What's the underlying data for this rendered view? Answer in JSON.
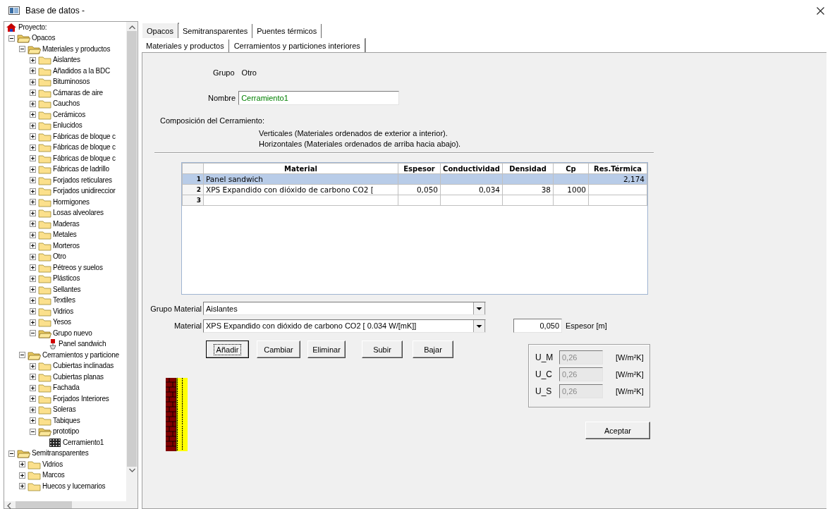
{
  "window": {
    "title": "Base de datos -"
  },
  "tree": [
    {
      "label": "Proyecto:",
      "kind": "root"
    },
    {
      "label": "Opacos",
      "kind": "folder",
      "expanded": true,
      "children": [
        {
          "label": "Materiales y productos",
          "kind": "folder",
          "expanded": true,
          "children": [
            {
              "label": "Aislantes",
              "kind": "folder",
              "expanded": false
            },
            {
              "label": "Añadidos a la BDC",
              "kind": "folder",
              "expanded": false
            },
            {
              "label": "Bituminosos",
              "kind": "folder",
              "expanded": false
            },
            {
              "label": "Cámaras de aire",
              "kind": "folder",
              "expanded": false
            },
            {
              "label": "Cauchos",
              "kind": "folder",
              "expanded": false
            },
            {
              "label": "Cerámicos",
              "kind": "folder",
              "expanded": false
            },
            {
              "label": "Enlucidos",
              "kind": "folder",
              "expanded": false
            },
            {
              "label": "Fábricas de bloque c",
              "kind": "folder",
              "expanded": false
            },
            {
              "label": "Fábricas de bloque c",
              "kind": "folder",
              "expanded": false
            },
            {
              "label": "Fábricas de bloque c",
              "kind": "folder",
              "expanded": false
            },
            {
              "label": "Fábricas de ladrillo",
              "kind": "folder",
              "expanded": false
            },
            {
              "label": "Forjados reticulares",
              "kind": "folder",
              "expanded": false
            },
            {
              "label": "Forjados unidireccior",
              "kind": "folder",
              "expanded": false
            },
            {
              "label": "Hormigones",
              "kind": "folder",
              "expanded": false
            },
            {
              "label": "Losas alveolares",
              "kind": "folder",
              "expanded": false
            },
            {
              "label": "Maderas",
              "kind": "folder",
              "expanded": false
            },
            {
              "label": "Metales",
              "kind": "folder",
              "expanded": false
            },
            {
              "label": "Morteros",
              "kind": "folder",
              "expanded": false
            },
            {
              "label": "Otro",
              "kind": "folder",
              "expanded": false
            },
            {
              "label": "Pétreos y suelos",
              "kind": "folder",
              "expanded": false
            },
            {
              "label": "Plásticos",
              "kind": "folder",
              "expanded": false
            },
            {
              "label": "Sellantes",
              "kind": "folder",
              "expanded": false
            },
            {
              "label": "Textiles",
              "kind": "folder",
              "expanded": false
            },
            {
              "label": "Vidrios",
              "kind": "folder",
              "expanded": false
            },
            {
              "label": "Yesos",
              "kind": "folder",
              "expanded": false
            },
            {
              "label": "Grupo nuevo",
              "kind": "folder",
              "expanded": true,
              "children": [
                {
                  "label": "Panel sandwich",
                  "kind": "material"
                }
              ]
            }
          ]
        },
        {
          "label": "Cerramientos y particione",
          "kind": "folder",
          "expanded": true,
          "children": [
            {
              "label": "Cubiertas inclinadas",
              "kind": "folder",
              "expanded": false
            },
            {
              "label": "Cubiertas planas",
              "kind": "folder",
              "expanded": false
            },
            {
              "label": "Fachada",
              "kind": "folder",
              "expanded": false
            },
            {
              "label": "Forjados Interiores",
              "kind": "folder",
              "expanded": false
            },
            {
              "label": "Soleras",
              "kind": "folder",
              "expanded": false
            },
            {
              "label": "Tabiques",
              "kind": "folder",
              "expanded": false
            },
            {
              "label": "prototipo",
              "kind": "folder",
              "expanded": true,
              "children": [
                {
                  "label": "Cerramiento1",
                  "kind": "cerramiento"
                }
              ]
            }
          ]
        }
      ]
    },
    {
      "label": "Semitransparentes",
      "kind": "folder",
      "expanded": true,
      "children": [
        {
          "label": "Vidrios",
          "kind": "folder",
          "expanded": false
        },
        {
          "label": "Marcos",
          "kind": "folder",
          "expanded": false
        },
        {
          "label": "Huecos y lucernarios",
          "kind": "folder",
          "expanded": false
        }
      ]
    }
  ],
  "tabs": [
    {
      "label": "Opacos",
      "selected": true
    },
    {
      "label": "Semitransparentes",
      "selected": false
    },
    {
      "label": "Puentes térmicos",
      "selected": false
    }
  ],
  "subtabs": [
    {
      "label": "Materiales y productos",
      "selected": false
    },
    {
      "label": "Cerramientos y particiones interiores",
      "selected": true
    }
  ],
  "grupo": {
    "label": "Grupo",
    "value": "Otro"
  },
  "nombre": {
    "label": "Nombre",
    "value": "Cerramiento1"
  },
  "composicion": {
    "title": "Composición del Cerramiento:",
    "notes": [
      "Verticales (Materiales ordenados de exterior a interior).",
      "Horizontales (Materiales ordenados de arriba hacia abajo)."
    ]
  },
  "table": {
    "columns": [
      "Material",
      "Espesor",
      "Conductividad",
      "Densidad",
      "Cp",
      "Res.Térmica"
    ],
    "rows": [
      {
        "number": "1",
        "selected": true,
        "cells": {
          "material": "Panel sandwich",
          "res_termica": "2,174"
        }
      },
      {
        "number": "2",
        "selected": false,
        "cells": {
          "material": "XPS Expandido con dióxido de carbono CO2 [",
          "espesor": "0,050",
          "conductividad": "0,034",
          "densidad": "38",
          "cp": "1000"
        }
      },
      {
        "number": "3",
        "selected": false,
        "cells": {}
      }
    ]
  },
  "grupo_material": {
    "label": "Grupo Material",
    "value": "Aislantes"
  },
  "material": {
    "label": "Material",
    "value": "XPS Expandido con dióxido de carbono CO2 [ 0.034 W/[mK]]"
  },
  "espesor": {
    "value": "0,050",
    "label": "Espesor [m]"
  },
  "buttons": [
    {
      "label": "Añadir",
      "focused": true
    },
    {
      "label": "Cambiar",
      "focused": false
    },
    {
      "label": "Eliminar",
      "focused": false
    },
    {
      "label": "Subir",
      "focused": false
    },
    {
      "label": "Bajar",
      "focused": false
    }
  ],
  "u_values": [
    {
      "label": "U_M",
      "value": "0,26",
      "unit": "[W/m²K]",
      "disabled": true
    },
    {
      "label": "U_C",
      "value": "0,26",
      "unit": "[W/m²K]",
      "disabled": true
    },
    {
      "label": "U_S",
      "value": "0,26",
      "unit": "[W/m²K]",
      "disabled": true
    }
  ],
  "accept_button": {
    "label": "Aceptar"
  }
}
